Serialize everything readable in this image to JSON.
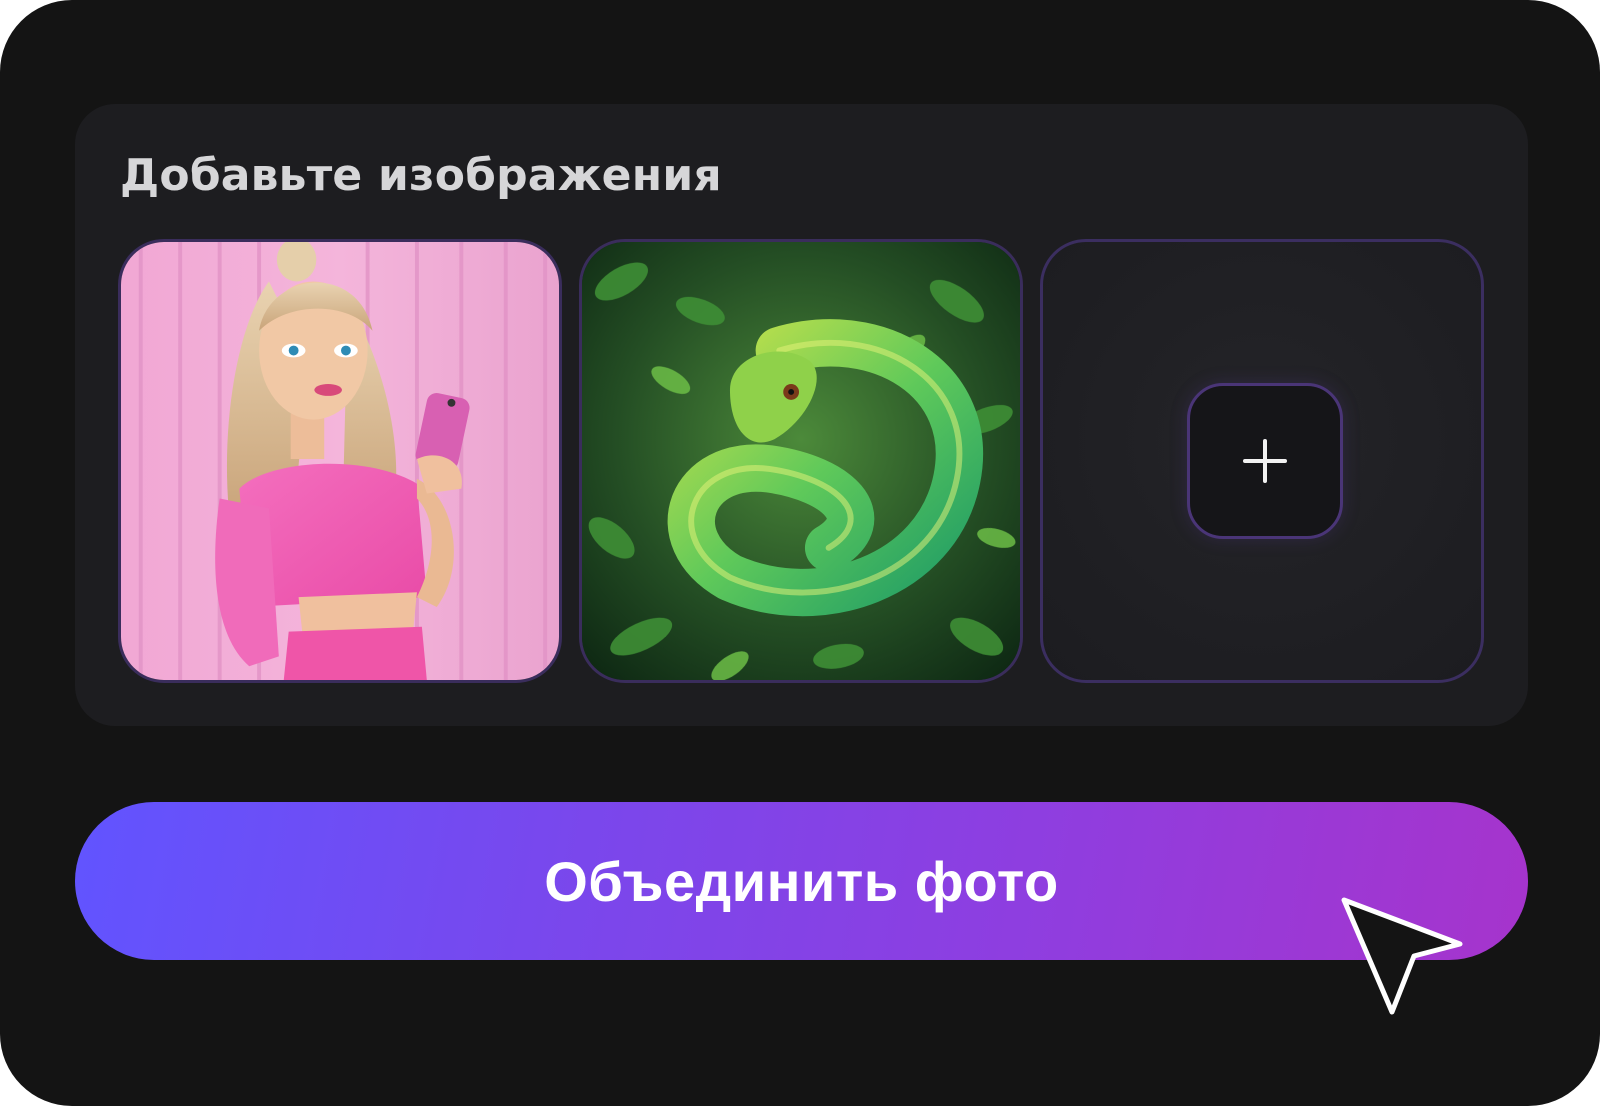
{
  "panel": {
    "title": "Добавьте изображения",
    "slots": [
      {
        "type": "image",
        "subject": "woman-in-pink-with-phone"
      },
      {
        "type": "image",
        "subject": "green-snake-in-leaves"
      },
      {
        "type": "add",
        "icon": "plus-icon"
      }
    ]
  },
  "merge_button": {
    "label": "Объединить фото",
    "gradient_start": "#6154ff",
    "gradient_end": "#a634cc"
  },
  "cursor": {
    "icon": "arrow-cursor-icon"
  },
  "colors": {
    "background": "#141414",
    "panel": "#1d1d20",
    "slot_border": "#3a2d5c",
    "title_text": "#d6d6d8"
  }
}
